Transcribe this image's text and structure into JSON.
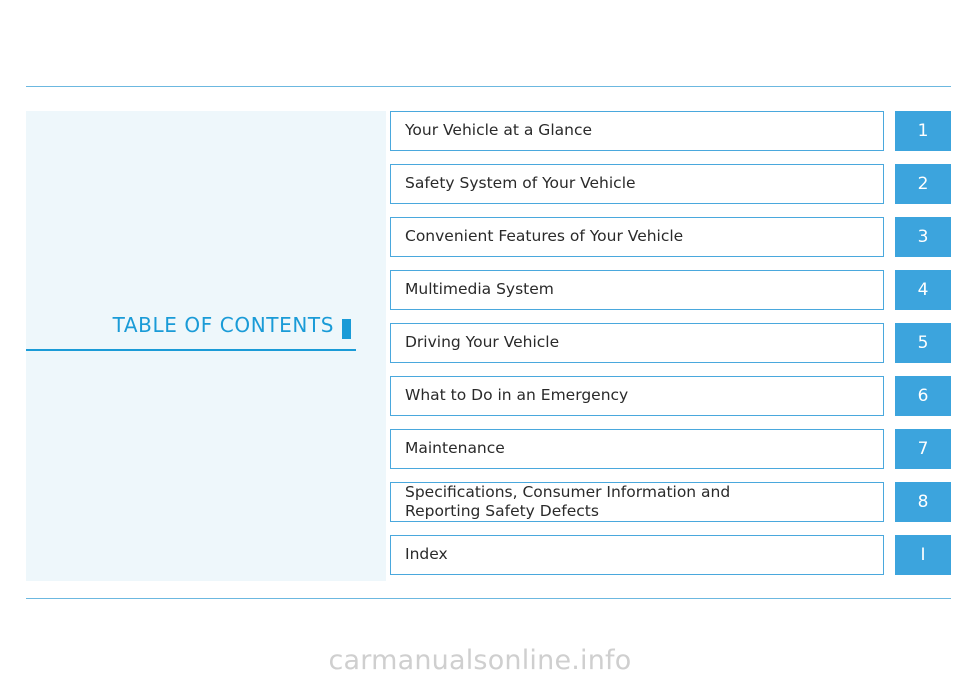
{
  "document": {
    "toc_heading": "TABLE OF CONTENTS",
    "watermark": "carmanualsonline.info"
  },
  "colors": {
    "accent": "#1a9bd7",
    "row_number_bg": "#3ca4dd",
    "row_border": "#4aa8dd",
    "panel_bg": "#eef7fb",
    "rule": "#6cb8e0"
  },
  "contents": [
    {
      "label": "Your Vehicle at a Glance",
      "label2": "",
      "number": "1"
    },
    {
      "label": "Safety System of Your Vehicle",
      "label2": "",
      "number": "2"
    },
    {
      "label": "Convenient Features of Your Vehicle",
      "label2": "",
      "number": "3"
    },
    {
      "label": "Multimedia System",
      "label2": "",
      "number": "4"
    },
    {
      "label": "Driving Your Vehicle",
      "label2": "",
      "number": "5"
    },
    {
      "label": "What to Do in an Emergency",
      "label2": "",
      "number": "6"
    },
    {
      "label": "Maintenance",
      "label2": "",
      "number": "7"
    },
    {
      "label": "Specifications, Consumer Information and",
      "label2": "Reporting Safety Defects",
      "number": "8"
    },
    {
      "label": "Index",
      "label2": "",
      "number": "I"
    }
  ]
}
